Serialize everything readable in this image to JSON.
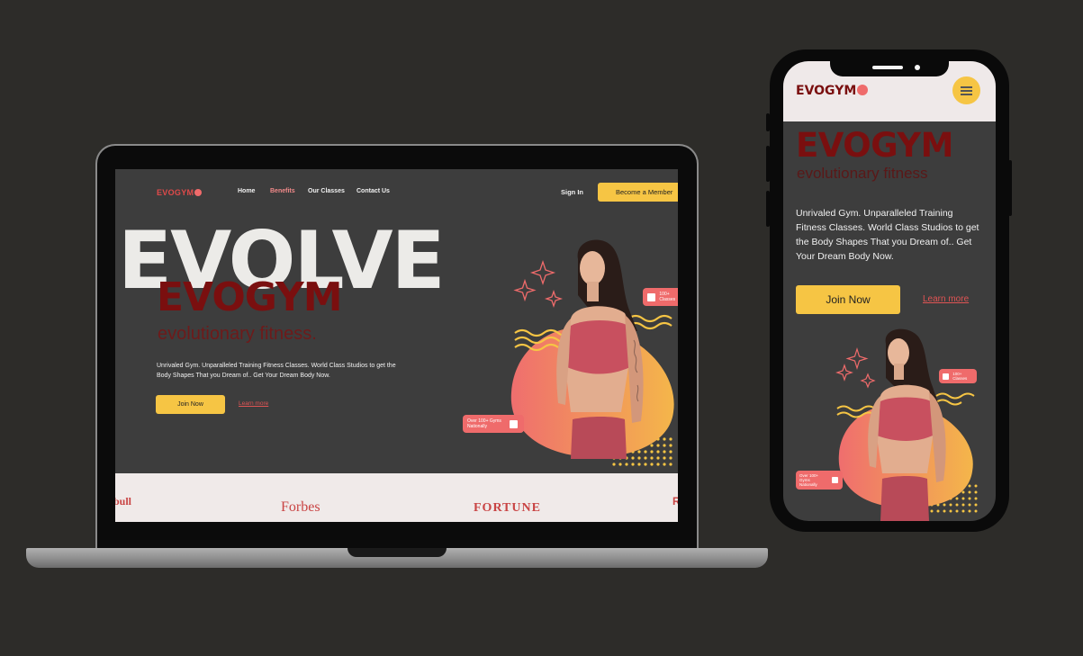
{
  "colors": {
    "background": "#2d2c29",
    "accent_yellow": "#f6c544",
    "accent_red": "#ef6b6b",
    "dark_red": "#7a0f0f",
    "screen_bg": "#3d3d3d"
  },
  "desktop": {
    "nav": {
      "logo": "EVOGYM",
      "links": [
        "Home",
        "Benefits",
        "Our Classes",
        "Contact Us"
      ],
      "active_link": "Benefits",
      "sign_in": "Sign In",
      "cta": "Become a Member"
    },
    "hero": {
      "headline_bg": "EVOLVE",
      "headline": "EVOGYM",
      "tagline": "evolutionary fitness.",
      "description": "Unrivaled Gym. Unparalleled Training Fitness Classes. World Class Studios to get the Body Shapes That you Dream of.. Get Your Dream Body Now.",
      "join_label": "Join Now",
      "learn_label": "Learn more",
      "badge_top": "100+ Classes",
      "badge_bottom": "Over 100+ Gyms Nationally"
    },
    "brands": {
      "left": "bull",
      "forbes": "Forbes",
      "fortune": "FORTUNE",
      "right": "R"
    }
  },
  "mobile": {
    "logo": "EVOGYM",
    "menu_icon": "hamburger-icon",
    "headline": "EVOGYM",
    "tagline": "evolutionary fitness",
    "description": "Unrivaled Gym. Unparalleled Training Fitness Classes. World Class Studios to get the Body Shapes That you Dream of.. Get Your Dream Body Now.",
    "join_label": "Join Now",
    "learn_label": "Learn more",
    "badge_top": "100+ Classes",
    "badge_bottom": "Over 100+ Gyms Nationally"
  }
}
